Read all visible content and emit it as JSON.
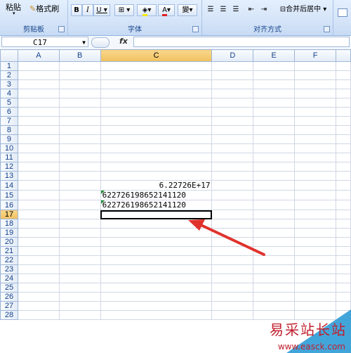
{
  "ribbon": {
    "clipboard": {
      "paste_label": "粘贴",
      "format_painter_label": "格式刷",
      "group_label": "剪贴板"
    },
    "font": {
      "bold": "B",
      "italic": "I",
      "underline": "U",
      "font_color_letter": "A",
      "phonetic": "變",
      "group_label": "字体"
    },
    "alignment": {
      "merge_center_label": "合并后居中",
      "group_label": "对齐方式"
    }
  },
  "formula_bar": {
    "name_box_value": "C17",
    "fx_label": "fx",
    "formula_value": ""
  },
  "columns": [
    "A",
    "B",
    "C",
    "D",
    "E",
    "F"
  ],
  "rows": [
    "1",
    "2",
    "3",
    "4",
    "5",
    "6",
    "7",
    "8",
    "9",
    "10",
    "11",
    "12",
    "13",
    "14",
    "15",
    "16",
    "17",
    "18",
    "19",
    "20",
    "21",
    "22",
    "23",
    "24",
    "25",
    "26",
    "27",
    "28"
  ],
  "cells": {
    "C14": "6.22726E+17",
    "C15": "622726198652141120",
    "C16": "622726198652141120"
  },
  "selected_cell": "C17",
  "watermark": {
    "text": "易采站长站",
    "url": "www.easck.com"
  },
  "colors": {
    "annotation_arrow": "#e0322c",
    "selection_header": "#f1c15f",
    "error_triangle": "#1e8e2f"
  }
}
